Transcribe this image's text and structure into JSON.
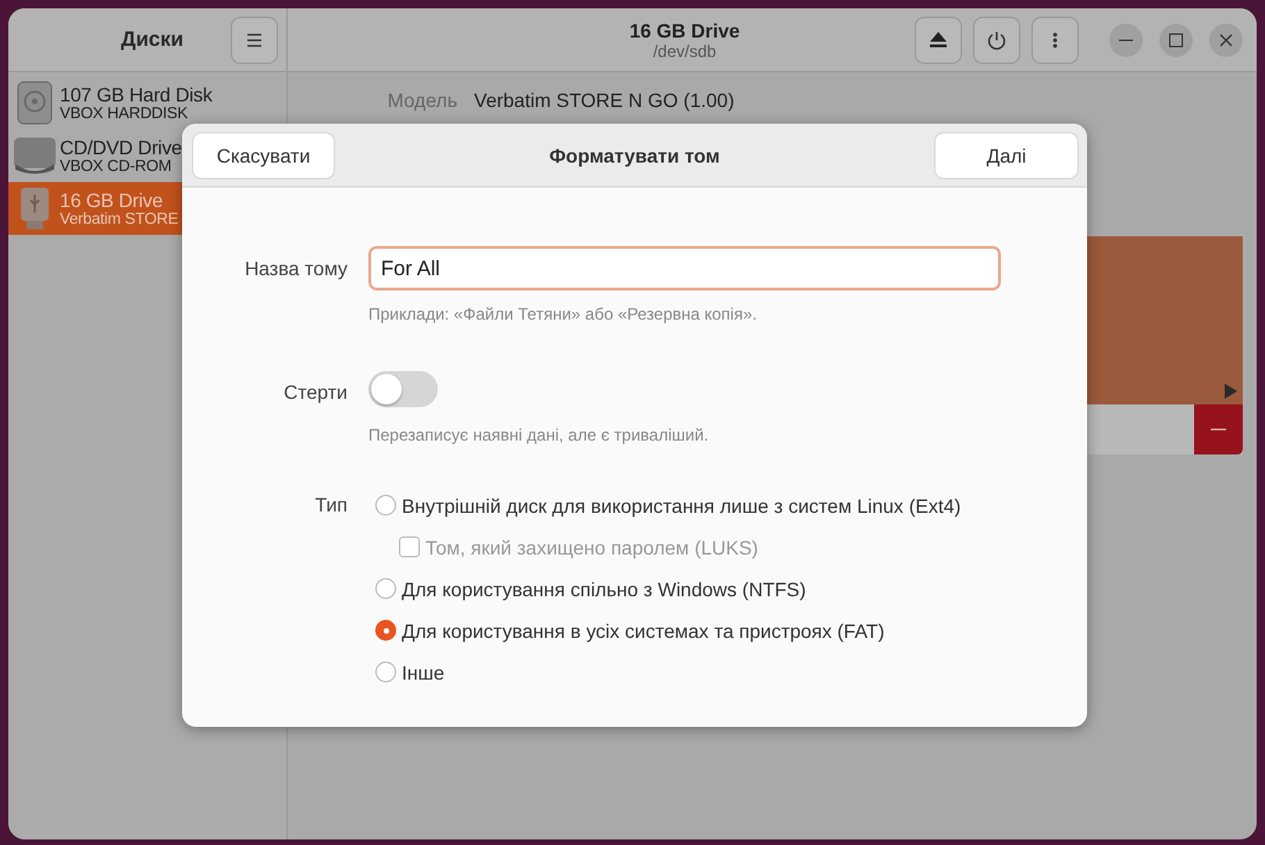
{
  "window": {
    "sidebar_title": "Диски",
    "title": "16 GB Drive",
    "subtitle": "/dev/sdb"
  },
  "disks": [
    {
      "name": "107 GB Hard Disk",
      "model": "VBOX HARDDISK",
      "kind": "hdd",
      "selected": false
    },
    {
      "name": "CD/DVD Drive",
      "model": "VBOX CD-ROM",
      "kind": "optical",
      "selected": false
    },
    {
      "name": "16 GB Drive",
      "model": "Verbatim STORE",
      "kind": "usb",
      "selected": true
    }
  ],
  "details": [
    {
      "label": "Модель",
      "value": "Verbatim STORE N GO (1.00)"
    }
  ],
  "dialog": {
    "title": "Форматувати том",
    "cancel": "Скасувати",
    "next": "Далі",
    "name_label": "Назва тому",
    "name_value": "For All",
    "name_hint": "Приклади: «Файли Тетяни» або «Резервна копія».",
    "erase_label": "Стерти",
    "erase_on": false,
    "erase_hint": "Перезаписує наявні дані, але є триваліший.",
    "type_label": "Тип",
    "options": [
      {
        "kind": "radio",
        "label": "Внутрішній диск для використання лише з систем Linux (Ext4)",
        "selected": false
      },
      {
        "kind": "checkbox",
        "label": "Том, який захищено паролем (LUKS)",
        "checked": false,
        "disabled": true
      },
      {
        "kind": "radio",
        "label": "Для користування спільно з Windows (NTFS)",
        "selected": false
      },
      {
        "kind": "radio",
        "label": "Для користування в усіх системах та пристроях (FAT)",
        "selected": true
      },
      {
        "kind": "radio",
        "label": "Інше",
        "selected": false
      }
    ]
  }
}
